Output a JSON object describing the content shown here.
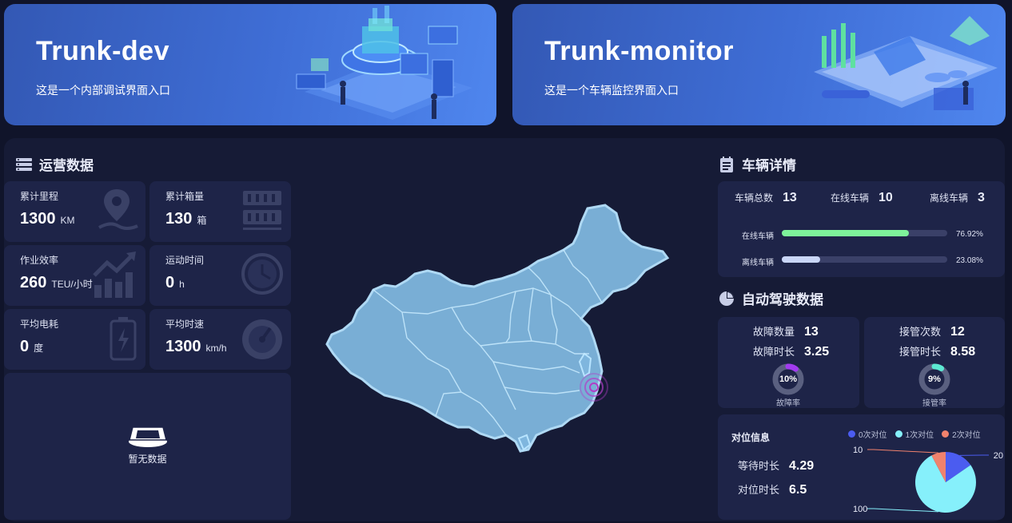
{
  "entries": [
    {
      "title": "Trunk-dev",
      "subtitle": "这是一个内部调试界面入口"
    },
    {
      "title": "Trunk-monitor",
      "subtitle": "这是一个车辆监控界面入口"
    }
  ],
  "operations": {
    "title": "运营数据",
    "stats": [
      {
        "label": "累计里程",
        "value": "1300",
        "unit": "KM",
        "icon": "map-pin-icon"
      },
      {
        "label": "累计箱量",
        "value": "130",
        "unit": "箱",
        "icon": "container-icon"
      },
      {
        "label": "作业效率",
        "value": "260",
        "unit": "TEU/小时",
        "icon": "trend-chart-icon"
      },
      {
        "label": "运动时间",
        "value": "0",
        "unit": "h",
        "icon": "clock-icon"
      },
      {
        "label": "平均电耗",
        "value": "0",
        "unit": "度",
        "icon": "battery-icon"
      },
      {
        "label": "平均时速",
        "value": "1300",
        "unit": "km/h",
        "icon": "speedometer-icon"
      }
    ],
    "empty_text": "暂无数据"
  },
  "vehicle": {
    "title": "车辆详情",
    "total_label": "车辆总数",
    "total": "13",
    "online_label": "在线车辆",
    "online": "10",
    "offline_label": "离线车辆",
    "offline": "3",
    "bars": [
      {
        "label": "在线车辆",
        "pct_text": "76.92%",
        "fraction": 0.7692,
        "color": "#7ef29a"
      },
      {
        "label": "离线车辆",
        "pct_text": "23.08%",
        "fraction": 0.2308,
        "color": "#c9d6f7"
      }
    ]
  },
  "autonomous": {
    "title": "自动驾驶数据",
    "fault": {
      "count_label": "故障数量",
      "count": "13",
      "duration_label": "故障时长",
      "duration": "3.25",
      "rate_text": "10%",
      "rate": 0.1,
      "rate_label": "故障率",
      "color": "#a23bf0"
    },
    "takeover": {
      "count_label": "接管次数",
      "count": "12",
      "duration_label": "接管时长",
      "duration": "8.58",
      "rate_text": "9%",
      "rate": 0.09,
      "rate_label": "接管率",
      "color": "#5ce8d2"
    }
  },
  "alignment": {
    "title": "对位信息",
    "wait_label": "等待时长",
    "wait": "4.29",
    "align_label": "对位时长",
    "align": "6.5"
  },
  "chart_data": {
    "type": "pie",
    "categories": [
      "0次对位",
      "1次对位",
      "2次对位"
    ],
    "values": [
      20,
      100,
      10
    ],
    "colors": [
      "#4b5cf0",
      "#86f0fb",
      "#f0826d"
    ]
  }
}
